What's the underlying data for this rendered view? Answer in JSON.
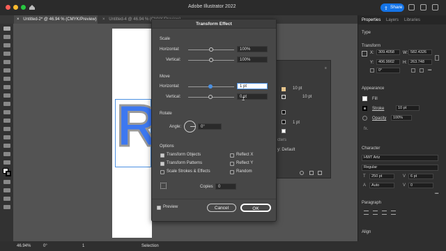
{
  "app": {
    "title": "Adobe Illustrator 2022",
    "share_label": "Share"
  },
  "tabs": [
    {
      "label": "Untitled-2* @ 46.94 % (CMYK/Preview)",
      "close": "×"
    },
    {
      "label": "Untitled-4 @ 46.94 % (CMYK/Preview)",
      "close": "×"
    }
  ],
  "canvas": {
    "letters": "R"
  },
  "status": {
    "zoom": "46.94%",
    "rotation": "0°",
    "artboard": "1",
    "mode": "Selection"
  },
  "dialog": {
    "title": "Transform Effect",
    "scale": {
      "heading": "Scale",
      "horizontal_label": "Horizontal:",
      "horizontal_value": "100%",
      "horizontal_level": 1.0,
      "vertical_label": "Vertical:",
      "vertical_value": "100%",
      "vertical_level": 1.0
    },
    "move": {
      "heading": "Move",
      "horizontal_label": "Horizontal:",
      "horizontal_value": "1 pt",
      "vertical_label": "Vertical:",
      "vertical_value": "0 pt"
    },
    "rotate": {
      "heading": "Rotate",
      "angle_label": "Angle:",
      "angle_value": "0°"
    },
    "options": {
      "heading": "Options",
      "transform_objects": "Transform Objects",
      "reflect_x": "Reflect X",
      "transform_patterns": "Transform Patterns",
      "reflect_y": "Reflect Y",
      "scale_strokes": "Scale Strokes & Effects",
      "random": "Random",
      "copies_label": "Copies",
      "copies_value": "0"
    },
    "preview_label": "Preview",
    "cancel_label": "Cancel",
    "ok_label": "OK"
  },
  "floating_panel": {
    "row1": "10 pt",
    "row2": "10 pt",
    "row3": "1 pt",
    "footer": "y: Default",
    "partial": "cters"
  },
  "panel": {
    "tabs": [
      "Properties",
      "Layers",
      "Libraries"
    ],
    "type_heading": "Type",
    "transform_heading": "Transform",
    "x_label": "X:",
    "x_value": "309.4058",
    "y_label": "Y:",
    "y_value": "406.9902",
    "w_label": "W:",
    "w_value": "582.4326",
    "h_label": "H:",
    "h_value": "263.748",
    "angle_value": "0°",
    "appearance_heading": "Appearance",
    "fill_label": "Fill",
    "stroke_label": "Stroke",
    "stroke_value": "10 pt",
    "opacity_label": "Opacity",
    "opacity_value": "100%",
    "fx_label": "fx.",
    "character_heading": "Character",
    "font_name": "HWT Artz",
    "font_style": "Regular",
    "font_size": "250 pt",
    "leading": "Auto",
    "tracking": "6 pt",
    "kerning": "0",
    "more": "•••",
    "paragraph_heading": "Paragraph",
    "align_heading": "Align"
  },
  "colors": {
    "accent": "#1473e6",
    "blue_letter": "#3d78f0"
  }
}
